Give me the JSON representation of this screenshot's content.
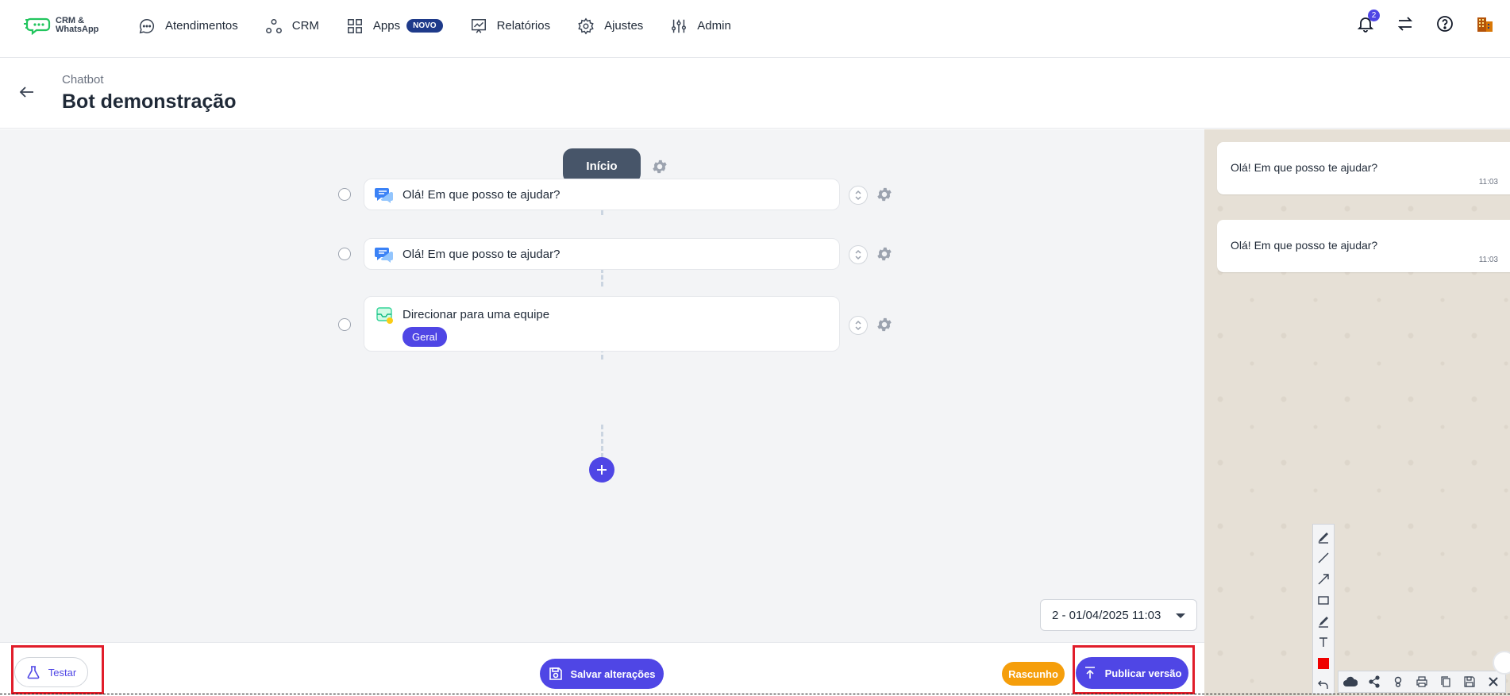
{
  "logo": {
    "line1": "CRM &",
    "line2": "WhatsApp"
  },
  "nav": {
    "items": [
      {
        "label": "Atendimentos",
        "icon": "chat-bubble-icon"
      },
      {
        "label": "CRM",
        "icon": "crm-nodes-icon"
      },
      {
        "label": "Apps",
        "icon": "apps-grid-icon",
        "badge": "NOVO"
      },
      {
        "label": "Relatórios",
        "icon": "report-chart-icon"
      },
      {
        "label": "Ajustes",
        "icon": "gear-icon"
      },
      {
        "label": "Admin",
        "icon": "sliders-icon"
      }
    ],
    "notification_count": "2"
  },
  "header": {
    "breadcrumb": "Chatbot",
    "title": "Bot demonstração"
  },
  "flow": {
    "start_label": "Início",
    "steps": [
      {
        "type": "message",
        "text": "Olá! Em que posso te ajudar?",
        "icon": "message-bubbles-icon"
      },
      {
        "type": "message",
        "text": "Olá! Em que posso te ajudar?",
        "icon": "message-bubbles-icon"
      },
      {
        "type": "team",
        "text": "Direcionar para uma equipe",
        "tag": "Geral",
        "icon": "team-inbox-icon"
      }
    ]
  },
  "version_select": {
    "value": "2 - 01/04/2025 11:03"
  },
  "chat": {
    "messages": [
      {
        "text": "Olá! Em que posso te ajudar?",
        "time": "11:03"
      },
      {
        "text": "Olá! Em que posso te ajudar?",
        "time": "11:03"
      }
    ]
  },
  "footer": {
    "test_label": "Testar",
    "save_label": "Salvar alterações",
    "draft_label": "Rascunho",
    "publish_label": "Publicar versão"
  },
  "colors": {
    "accent": "#4f46e5",
    "draft": "#f59e0b",
    "highlight": "#e11d2a",
    "start_node": "#475569"
  }
}
